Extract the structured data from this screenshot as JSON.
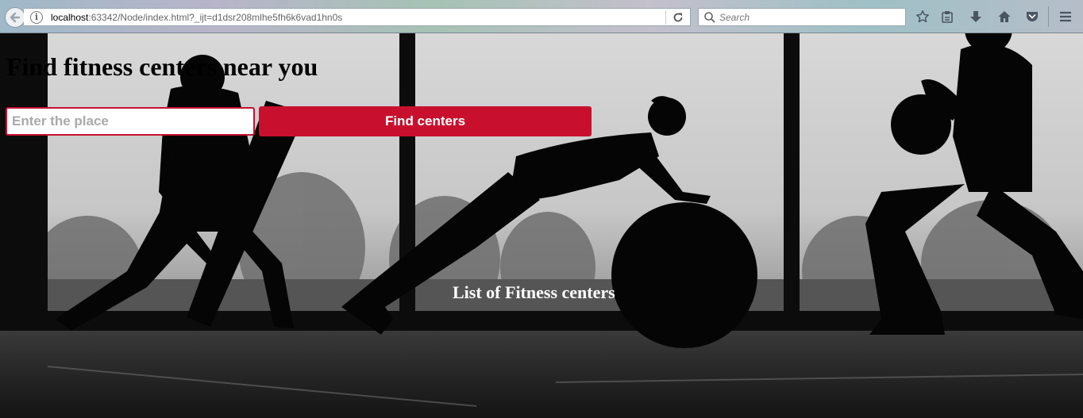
{
  "browser": {
    "url_host": "localhost",
    "url_rest": ":63342/Node/index.html?_ijt=d1dsr208mlhe5fh6k6vad1hn0s",
    "search_placeholder": "Search"
  },
  "page": {
    "heading": "Find fitness centers near you",
    "place_input": {
      "placeholder": "Enter the place",
      "value": ""
    },
    "find_button_label": "Find centers",
    "list_heading": "List of Fitness centers"
  },
  "colors": {
    "accent": "#c8102e"
  }
}
